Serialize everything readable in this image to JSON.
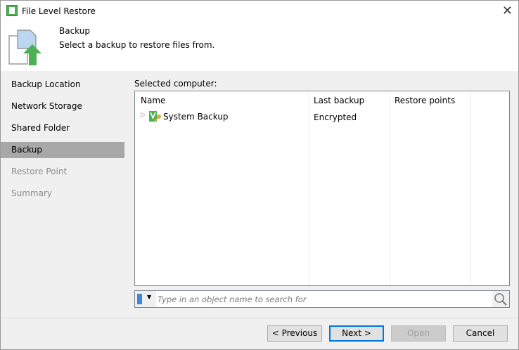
{
  "window": {
    "title": "File Level Restore"
  },
  "header": {
    "title": "Backup",
    "subtitle": "Select a backup to restore files from."
  },
  "sidebar": {
    "items": [
      {
        "label": "Backup Location",
        "state": "normal"
      },
      {
        "label": "Network Storage",
        "state": "normal"
      },
      {
        "label": "Shared Folder",
        "state": "normal"
      },
      {
        "label": "Backup",
        "state": "selected"
      },
      {
        "label": "Restore Point",
        "state": "disabled"
      },
      {
        "label": "Summary",
        "state": "disabled"
      }
    ]
  },
  "main": {
    "selected_label": "Selected computer:",
    "columns": [
      "Name",
      "Last backup",
      "Restore points"
    ],
    "rows": [
      {
        "name": "System Backup",
        "last_backup": "Encrypted",
        "restore_points": ""
      }
    ],
    "search_placeholder": "Type in an object name to search for"
  },
  "buttons": {
    "previous": "< Previous",
    "next": "Next >",
    "open": "Open",
    "cancel": "Cancel"
  },
  "colors": {
    "accent": "#0078d7",
    "green": "#4caf50"
  }
}
